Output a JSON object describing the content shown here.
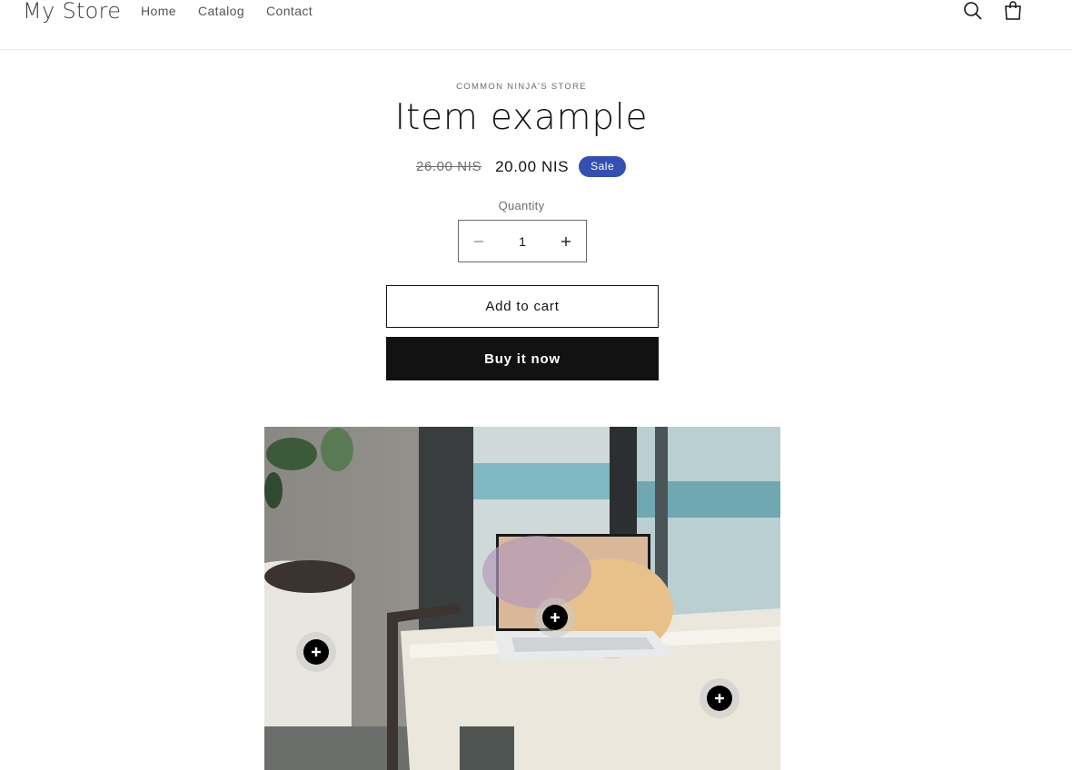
{
  "header": {
    "logo": "My Store",
    "nav": [
      "Home",
      "Catalog",
      "Contact"
    ],
    "icons": [
      "search-icon",
      "cart-icon"
    ]
  },
  "product": {
    "vendor": "COMMON NINJA'S STORE",
    "title": "Item example",
    "price_old": "26.00 NIS",
    "price_new": "20.00 NIS",
    "badge": "Sale",
    "quantity_label": "Quantity",
    "quantity_value": "1",
    "add_to_cart": "Add to cart",
    "buy_now": "Buy it now"
  },
  "hotspots": [
    "plus-icon",
    "plus-icon",
    "plus-icon"
  ],
  "colors": {
    "accent_badge": "#334fb4",
    "buy_button": "#121212",
    "text": "#121212"
  }
}
